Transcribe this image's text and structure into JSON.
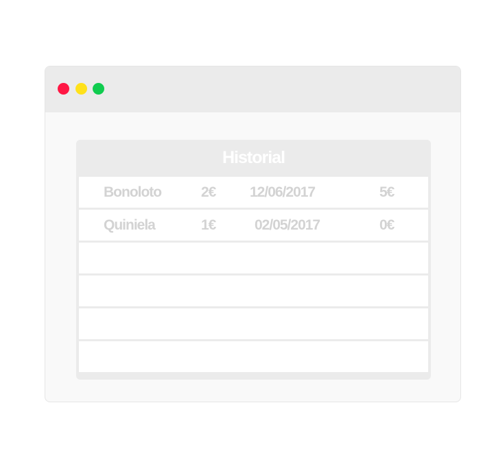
{
  "window": {
    "controls": {
      "close_color": "#ff1744",
      "minimize_color": "#ffe11a",
      "maximize_color": "#10cc4f"
    }
  },
  "panel": {
    "title": "Historial",
    "rows": [
      {
        "game": "Bonoloto",
        "bet": "2€",
        "date": "12/06/2017",
        "win": "5€"
      },
      {
        "game": "Quiniela",
        "bet": "1€",
        "date": "02/05/2017",
        "win": "0€"
      },
      {
        "game": "",
        "bet": "",
        "date": "",
        "win": ""
      },
      {
        "game": "",
        "bet": "",
        "date": "",
        "win": ""
      },
      {
        "game": "",
        "bet": "",
        "date": "",
        "win": ""
      },
      {
        "game": "",
        "bet": "",
        "date": "",
        "win": ""
      }
    ]
  }
}
